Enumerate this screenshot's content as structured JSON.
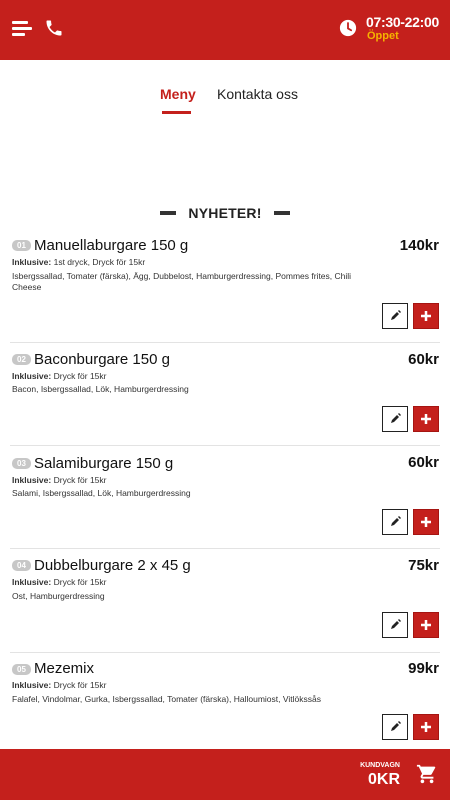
{
  "header": {
    "hours": "07:30-22:00",
    "status": "Öppet",
    "status_color": "#f5b400",
    "brand_color": "#c4201c",
    "icons": [
      "menu-icon",
      "phone-icon",
      "clock-icon"
    ]
  },
  "tabs": [
    {
      "label": "Meny",
      "active": true
    },
    {
      "label": "Kontakta oss",
      "active": false
    }
  ],
  "section": {
    "title": "NYHETER!"
  },
  "items": [
    {
      "number": "01",
      "name": "Manuellaburgare 150 g",
      "price": "140kr",
      "inclusive_label": "Inklusive:",
      "inclusive": "1st dryck, Dryck för 15kr",
      "description": "Isbergssallad, Tomater (färska), Ägg, Dubbelost, Hamburgerdressing, Pommes frites, Chili Cheese"
    },
    {
      "number": "02",
      "name": "Baconburgare 150 g",
      "price": "60kr",
      "inclusive_label": "Inklusive:",
      "inclusive": "Dryck för 15kr",
      "description": "Bacon, Isbergssallad, Lök, Hamburgerdressing"
    },
    {
      "number": "03",
      "name": "Salamiburgare 150 g",
      "price": "60kr",
      "inclusive_label": "Inklusive:",
      "inclusive": "Dryck för 15kr",
      "description": "Salami, Isbergssallad, Lök, Hamburgerdressing"
    },
    {
      "number": "04",
      "name": "Dubbelburgare 2 x 45 g",
      "price": "75kr",
      "inclusive_label": "Inklusive:",
      "inclusive": "Dryck för 15kr",
      "description": "Ost, Hamburgerdressing"
    },
    {
      "number": "05",
      "name": "Mezemix",
      "price": "99kr",
      "inclusive_label": "Inklusive:",
      "inclusive": "Dryck för 15kr",
      "description": "Falafel, Vindolmar, Gurka, Isbergssallad, Tomater (färska), Halloumiost, Vitlökssås"
    }
  ],
  "cart": {
    "label": "KUNDVAGN",
    "total": "0KR"
  }
}
